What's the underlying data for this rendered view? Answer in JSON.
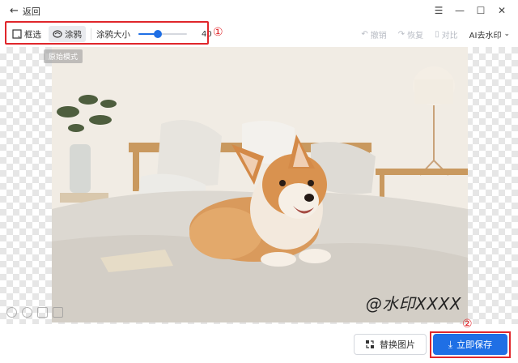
{
  "titlebar": {
    "back_label": "返回",
    "window_controls": [
      "menu-icon",
      "minimize-icon",
      "maximize-icon",
      "close-icon"
    ]
  },
  "toolbar": {
    "box_select_label": "框选",
    "brush_label": "涂鸦",
    "brush_size_label": "涂鸦大小",
    "brush_size_value": "40",
    "brush_size_fraction": 0.4,
    "marker_1": "①",
    "undo_label": "撤销",
    "redo_label": "恢复",
    "compare_label": "对比",
    "ai_remove_label": "AI去水印"
  },
  "canvas": {
    "compare_chip": "原始模式",
    "watermark_text": "@水印XXXX"
  },
  "bottom": {
    "replace_label": "替换图片",
    "save_label": "立即保存",
    "marker_2": "②"
  },
  "colors": {
    "accent": "#1f6fe5",
    "highlight": "#e0262b"
  }
}
